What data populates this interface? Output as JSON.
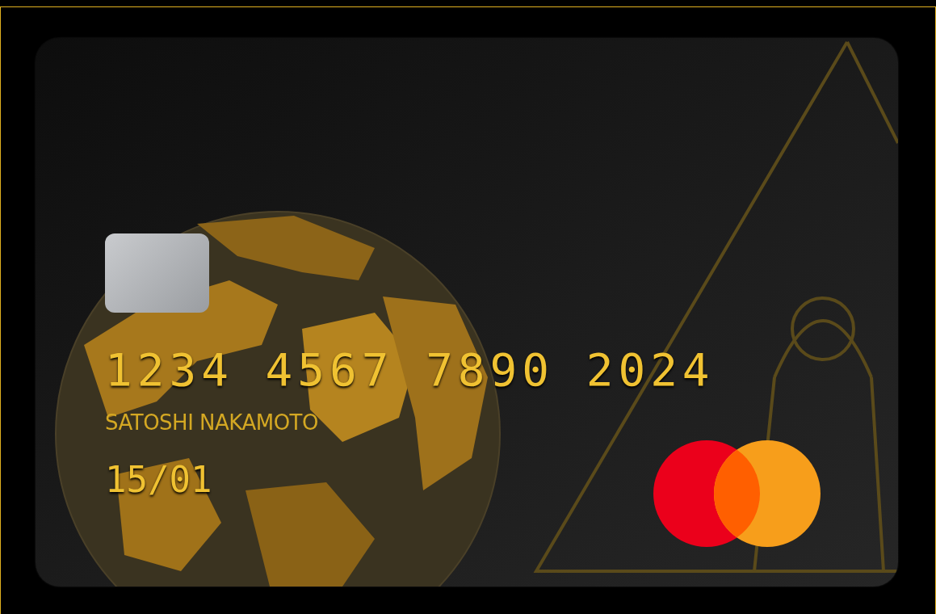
{
  "card": {
    "number": "1234 4567 7890 2024",
    "holder": "SATOSHI NAKAMOTO",
    "expiry": "15/01"
  }
}
